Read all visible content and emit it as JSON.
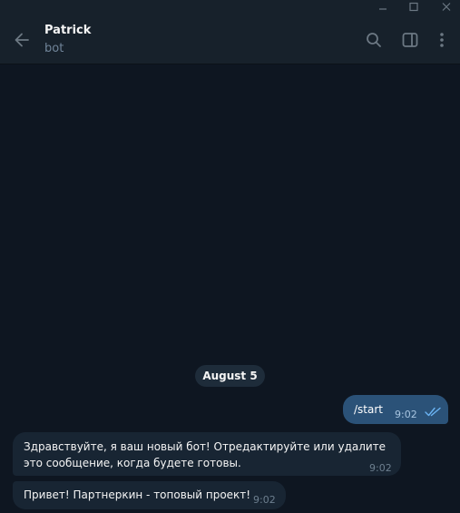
{
  "chat": {
    "name": "Patrick",
    "status": "bot"
  },
  "date_separator": "August 5",
  "messages": [
    {
      "direction": "out",
      "text": "/start",
      "time": "9:02",
      "read": true
    },
    {
      "direction": "in",
      "text": "Здравствуйте, я ваш новый бот! Отредактируйте или удалите это сообщение, когда будете готовы.",
      "time": "9:02"
    },
    {
      "direction": "in",
      "text": "Привет! Партнеркин - топовый проект!",
      "time": "9:02"
    }
  ],
  "icons": {
    "minimize": "minimize-icon",
    "maximize": "maximize-icon",
    "close": "close-icon",
    "back": "arrow-left-icon",
    "search": "search-icon",
    "sidebar": "sidebar-toggle-icon",
    "more": "more-vertical-icon",
    "read_receipt": "double-check-icon"
  },
  "colors": {
    "background": "#0e1621",
    "header": "#17212b",
    "outgoing_bubble": "#2b5278",
    "incoming_bubble": "#182533",
    "read_check": "#6ab3f3"
  }
}
